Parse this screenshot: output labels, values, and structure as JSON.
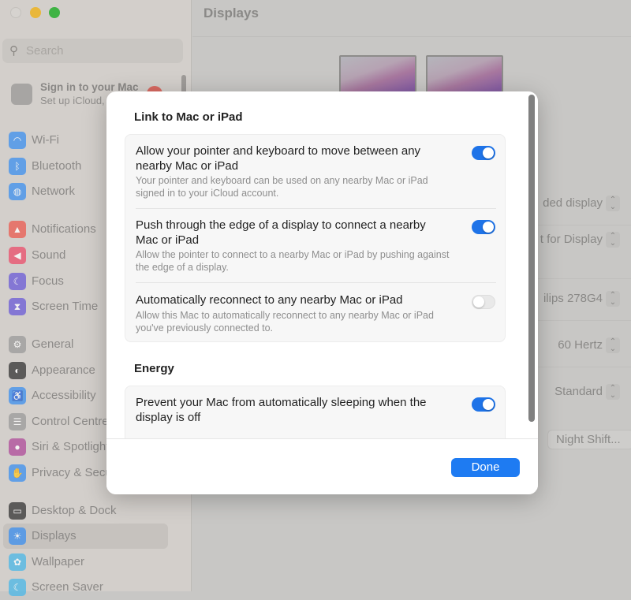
{
  "window": {
    "title": "Displays"
  },
  "sidebar": {
    "search_placeholder": "Search",
    "account": {
      "title": "Sign in to your Mac",
      "subtitle": "Set up iCloud,"
    },
    "items": [
      {
        "label": "Wi-Fi",
        "icon": "wifi-icon",
        "color": "#3b8ff0"
      },
      {
        "label": "Bluetooth",
        "icon": "bluetooth-icon",
        "color": "#3b8ff0"
      },
      {
        "label": "Network",
        "icon": "globe-icon",
        "color": "#3b8ff0"
      },
      {
        "label": "Notifications",
        "icon": "bell-icon",
        "color": "#ec5a50"
      },
      {
        "label": "Sound",
        "icon": "speaker-icon",
        "color": "#ec4d6a"
      },
      {
        "label": "Focus",
        "icon": "moon-icon",
        "color": "#6a5ad8"
      },
      {
        "label": "Screen Time",
        "icon": "hourglass-icon",
        "color": "#6a5ad8"
      },
      {
        "label": "General",
        "icon": "gear-icon",
        "color": "#9a9a9a"
      },
      {
        "label": "Appearance",
        "icon": "appearance-icon",
        "color": "#333333"
      },
      {
        "label": "Accessibility",
        "icon": "accessibility-icon",
        "color": "#3b8ff0"
      },
      {
        "label": "Control Centre",
        "icon": "control-centre-icon",
        "color": "#9a9a9a"
      },
      {
        "label": "Siri & Spotlight",
        "icon": "siri-icon",
        "color": "#b04a9a"
      },
      {
        "label": "Privacy & Security",
        "icon": "hand-icon",
        "color": "#3b8ff0"
      },
      {
        "label": "Desktop & Dock",
        "icon": "dock-icon",
        "color": "#333333"
      },
      {
        "label": "Displays",
        "icon": "sun-icon",
        "color": "#3b8ff0",
        "selected": true
      },
      {
        "label": "Wallpaper",
        "icon": "flower-icon",
        "color": "#4ab8e8"
      },
      {
        "label": "Screen Saver",
        "icon": "screensaver-icon",
        "color": "#4ab8e8"
      }
    ]
  },
  "main": {
    "settings": [
      "ded display",
      "t for Display",
      "ilips 278G4",
      "60 Hertz",
      "Standard"
    ],
    "night_shift_label": "Night Shift..."
  },
  "dialog": {
    "section1_title": "Link to Mac or iPad",
    "rows": [
      {
        "title": "Allow your pointer and keyboard to move between any nearby Mac or iPad",
        "desc": "Your pointer and keyboard can be used on any nearby Mac or iPad signed in to your iCloud account.",
        "on": true
      },
      {
        "title": "Push through the edge of a display to connect a nearby Mac or iPad",
        "desc": "Allow the pointer to connect to a nearby Mac or iPad by pushing against the edge of a display.",
        "on": true
      },
      {
        "title": "Automatically reconnect to any nearby Mac or iPad",
        "desc": "Allow this Mac to automatically reconnect to any nearby Mac or iPad you've previously connected to.",
        "on": false
      }
    ],
    "section2_title": "Energy",
    "energy_row": {
      "title": "Prevent your Mac from automatically sleeping when the display is off",
      "on": true
    },
    "done_label": "Done",
    "accent": "#1e73e8"
  }
}
